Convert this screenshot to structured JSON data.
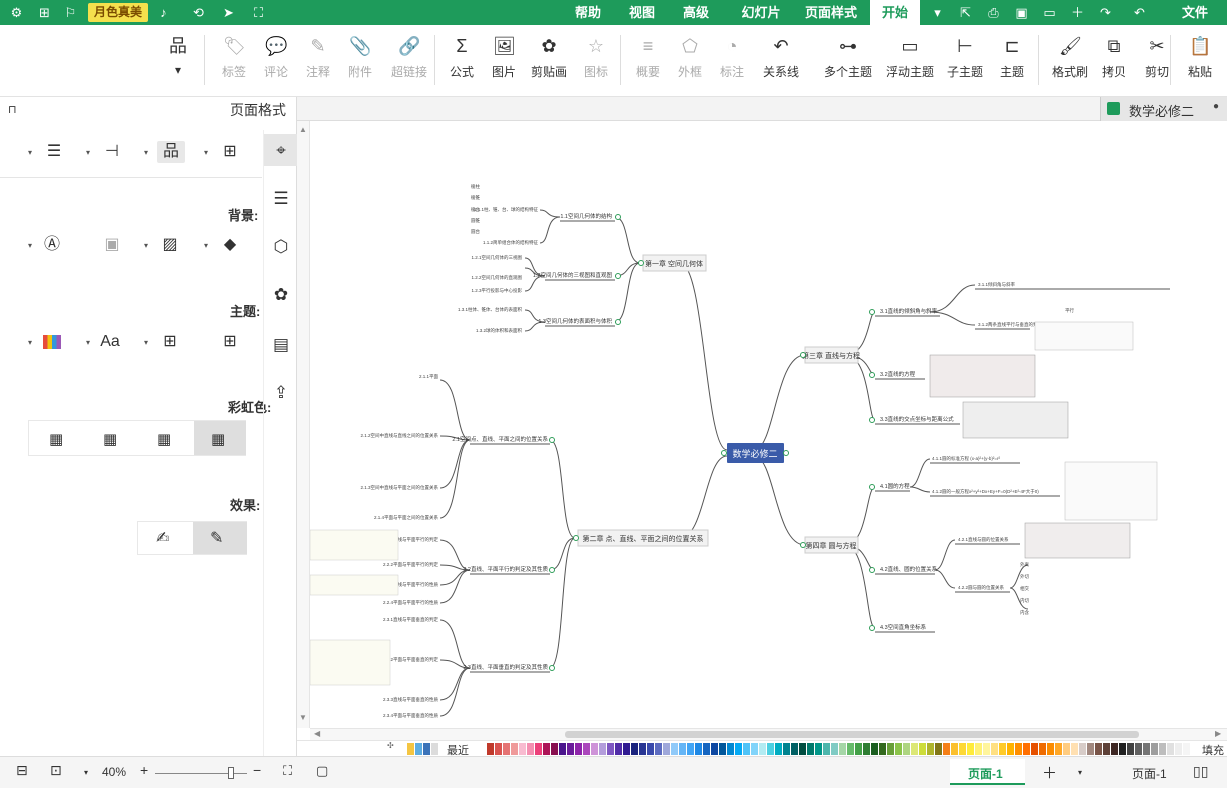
{
  "brand": {
    "label": "月色真美"
  },
  "menubar": {
    "file_label": "文件",
    "tabs": [
      "开始",
      "页面样式",
      "幻灯片",
      "高级",
      "视图",
      "帮助"
    ],
    "active_tab": "开始"
  },
  "ribbon": {
    "paste": "粘贴",
    "cut": "剪切",
    "copy": "拷贝",
    "format_painter": "格式刷",
    "topic": "主题",
    "subtopic": "子主题",
    "floating_topic": "浮动主题",
    "multi_topic": "多个主题",
    "relationship": "关系线",
    "callout": "标注",
    "boundary": "外框",
    "summary": "概要",
    "icon": "图标",
    "clipart": "剪贴画",
    "picture": "图片",
    "formula": "公式",
    "hyperlink": "超链接",
    "attachment": "附件",
    "note": "注释",
    "comment": "评论",
    "tag": "标签"
  },
  "document": {
    "tab_title": "数学必修二"
  },
  "panel": {
    "title": "页面格式",
    "background_label": "背景:",
    "theme_label": "主题:",
    "rainbow_label": "彩虹色:",
    "effect_label": "效果:",
    "font_icon_text": "Aa"
  },
  "mindmap": {
    "central": "数学必修二",
    "right_branches": [
      {
        "label": "第三章 直线与方程",
        "subs": [
          "3.1直线的倾斜角与斜率",
          "3.2直线的方程",
          "3.3直线的交点坐标与距离公式"
        ]
      },
      {
        "label": "第四章 圆与方程",
        "subs": [
          "4.1圆的方程",
          "4.2直线、圆的位置关系",
          "4.3空间直角坐标系"
        ]
      }
    ],
    "left_branches": [
      {
        "label": "第一章 空间几何体",
        "subs": [
          "1.1空间几何体的结构",
          "1.2空间几何体的三视图和直观图",
          "1.3空间几何体的表面积与体积"
        ]
      },
      {
        "label": "第二章 点、直线、平面之间的位置关系",
        "subs": [
          "2.1空间点、直线、平面之间的位置关系",
          "2.2直线、平面平行的判定及其性质",
          "2.3直线、平面垂直的判定及其性质"
        ]
      }
    ],
    "right_details": [
      "3.1.1倾斜角与斜率",
      "3.1.2两条直线平行与垂直的判定",
      "4.1.1圆的标准方程 (x-a)²+(y-b)²=r²",
      "4.1.2圆的一般方程x²+y²+Dx+Ey+F=0(D²+E²-4F大于0)",
      "4.2.1直线与圆的位置关系",
      "4.2.2圆与圆的位置关系",
      "外离",
      "外切",
      "相交",
      "内切",
      "内含",
      "重要",
      "平行"
    ],
    "left_details": [
      "1.1.1柱、锥、台、球的结构特征",
      "1.1.2简单组合体的结构特征",
      "棱柱",
      "棱锥",
      "棱台",
      "圆锥",
      "圆台",
      "1.2.1空间几何体的三视图",
      "1.2.2空间几何体的直观图",
      "1.2.3平行投影与中心投影",
      "1.3.1柱体、锥体、台体的表面积",
      "1.3.2球的体积和表面积",
      "2.1.1平面",
      "2.1.2空间中直线与直线之间的位置关系",
      "2.1.3空间中直线与平面之间的位置关系",
      "2.1.4平面与平面之间的位置关系",
      "2.2.1直线与平面平行的判定",
      "2.2.2平面与平面平行的判定",
      "2.2.3直线与平面平行的性质",
      "2.2.4平面与平面平行的性质",
      "2.3.1直线与平面垂直的判定",
      "2.3.2平面与平面垂直的判定",
      "2.3.3直线与平面垂直的性质",
      "2.3.4平面与平面垂直的性质"
    ]
  },
  "palette": {
    "fill_label": "填充",
    "recent_label": "最近",
    "colors": [
      "#c0392b",
      "#d9534f",
      "#e57373",
      "#ef9a9a",
      "#f8bbd0",
      "#f48fb1",
      "#ec407a",
      "#ad1457",
      "#880e4f",
      "#4a148c",
      "#6a1b9a",
      "#8e24aa",
      "#ab47bc",
      "#ce93d8",
      "#b39ddb",
      "#7e57c2",
      "#512da8",
      "#311b92",
      "#1a237e",
      "#283593",
      "#3949ab",
      "#5c6bc0",
      "#9fa8da",
      "#90caf9",
      "#64b5f6",
      "#42a5f5",
      "#1e88e5",
      "#1565c0",
      "#0d47a1",
      "#01579b",
      "#0288d1",
      "#03a9f4",
      "#4fc3f7",
      "#81d4fa",
      "#b2ebf2",
      "#4dd0e1",
      "#00acc1",
      "#00838f",
      "#006064",
      "#004d40",
      "#00796b",
      "#009688",
      "#4db6ac",
      "#80cbc4",
      "#a5d6a7",
      "#66bb6a",
      "#43a047",
      "#2e7d32",
      "#1b5e20",
      "#33691e",
      "#689f38",
      "#8bc34a",
      "#aed581",
      "#dce775",
      "#cddc39",
      "#afb42b",
      "#827717",
      "#f57f17",
      "#fbc02d",
      "#fdd835",
      "#ffeb3b",
      "#fff176",
      "#fff59d",
      "#ffe082",
      "#ffca28",
      "#ffb300",
      "#ff8f00",
      "#ff6f00",
      "#e65100",
      "#ef6c00",
      "#fb8c00",
      "#ffa726",
      "#ffcc80",
      "#ffe0b2",
      "#d7ccc8",
      "#a1887f",
      "#795548",
      "#5d4037",
      "#3e2723",
      "#212121",
      "#424242",
      "#616161",
      "#757575",
      "#9e9e9e",
      "#bdbdbd",
      "#e0e0e0",
      "#eeeeee",
      "#f5f5f5"
    ],
    "recent": [
      "#f4c542",
      "#5dade2",
      "#3b73b9",
      "#dcdcdc"
    ]
  },
  "status": {
    "page_tab": "页面-1",
    "page_label": "页面-1",
    "zoom": "40%"
  }
}
